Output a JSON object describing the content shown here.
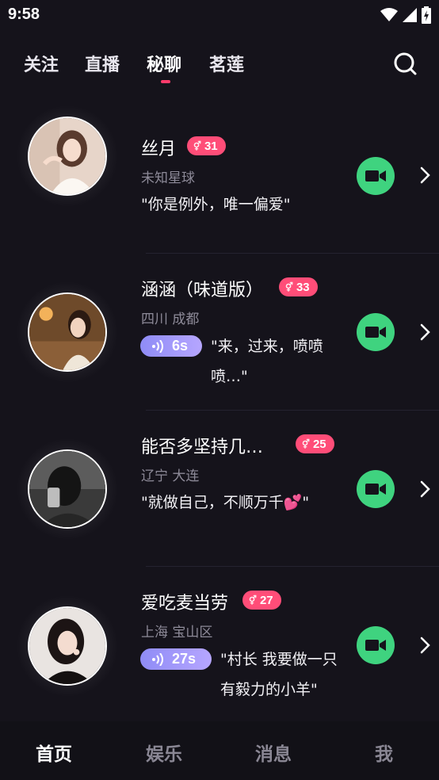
{
  "status_bar": {
    "time": "9:58"
  },
  "top_tabs": [
    "关注",
    "直播",
    "秘聊",
    "茗莲"
  ],
  "active_tab": "秘聊",
  "users": [
    {
      "name": "丝月",
      "badge": "31",
      "location": "未知星球",
      "voice": null,
      "quote": "\"你是例外，唯一偏爱\""
    },
    {
      "name": "涵涵（味道版）",
      "badge": "33",
      "location": "四川 成都",
      "voice": "6s",
      "quote": "\"来，过来，喷喷喷…\""
    },
    {
      "name": "能否多坚持几…",
      "badge": "25",
      "location": "辽宁 大连",
      "voice": null,
      "quote": "\"就做自己，不顺万千💕\""
    },
    {
      "name": "爱吃麦当劳",
      "badge": "27",
      "location": "上海 宝山区",
      "voice": "27s",
      "quote": "\"村长 我要做一只有毅力的小羊\""
    }
  ],
  "bottom_nav": [
    "首页",
    "娱乐",
    "消息",
    "我"
  ],
  "colors": {
    "background": "#15131b",
    "accent": "#ff3b6b",
    "badge": "#ff4d78",
    "video": "#3fd37f",
    "voice": "#9b95f8"
  }
}
